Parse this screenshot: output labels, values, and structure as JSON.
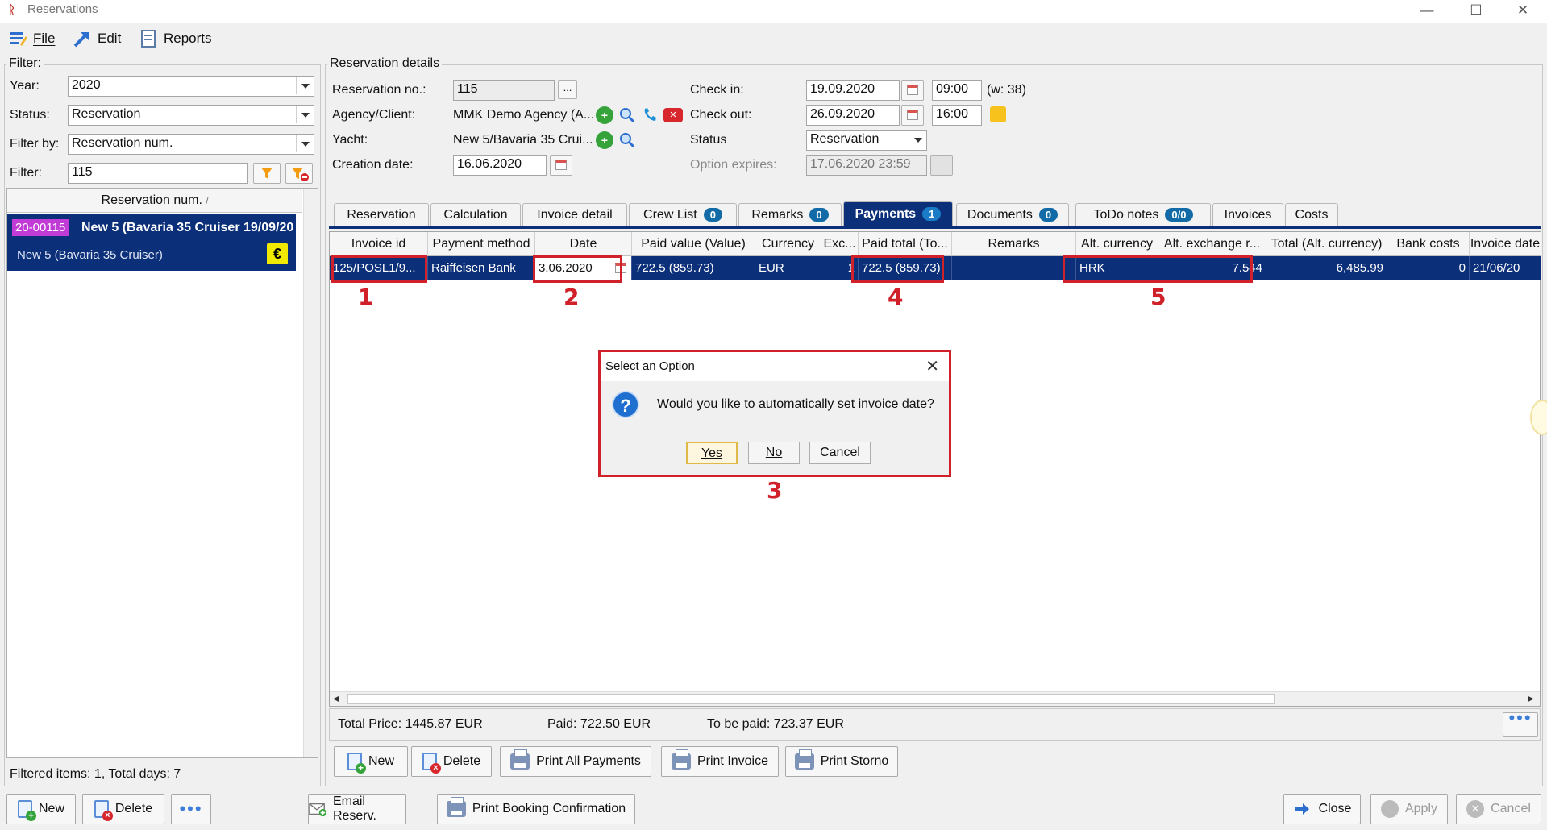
{
  "window": {
    "title": "Reservations"
  },
  "menu": {
    "file": "File",
    "edit": "Edit",
    "reports": "Reports"
  },
  "filter": {
    "legend": "Filter:",
    "year_label": "Year:",
    "year_value": "2020",
    "status_label": "Status:",
    "status_value": "Reservation",
    "filterby_label": "Filter by:",
    "filterby_value": "Reservation num.",
    "filter_label": "Filter:",
    "filter_value": "115"
  },
  "list": {
    "column_header": "Reservation num.",
    "sort_indicator": "/",
    "item": {
      "badge": "20-00115",
      "title": "New 5 (Bavaria 35 Cruiser 19/09/20",
      "subtitle": "New 5 (Bavaria 35 Cruiser)",
      "currency_symbol": "€"
    },
    "footer": "Filtered items: 1,  Total days: 7"
  },
  "details": {
    "legend": "Reservation details",
    "resno_label": "Reservation no.:",
    "resno_value": "115",
    "resno_btn": "...",
    "agency_label": "Agency/Client:",
    "agency_value": "MMK Demo Agency (A...",
    "yacht_label": "Yacht:",
    "yacht_value": "New 5/Bavaria 35 Crui...",
    "creation_label": "Creation date:",
    "creation_value": "16.06.2020",
    "checkin_label": "Check in:",
    "checkin_date": "19.09.2020",
    "checkin_time": "09:00",
    "week": "(w: 38)",
    "checkout_label": "Check out:",
    "checkout_date": "26.09.2020",
    "checkout_time": "16:00",
    "status_label": "Status",
    "status_value": "Reservation",
    "option_label": "Option expires:",
    "option_value": "17.06.2020 23:59"
  },
  "tabs": [
    {
      "label": "Reservation"
    },
    {
      "label": "Calculation"
    },
    {
      "label": "Invoice detail"
    },
    {
      "label": "Crew List",
      "badge": "0"
    },
    {
      "label": "Remarks",
      "badge": "0"
    },
    {
      "label": "Payments",
      "badge": "1"
    },
    {
      "label": "Documents",
      "badge": "0"
    },
    {
      "label": "ToDo notes",
      "badge": "0/0"
    },
    {
      "label": "Invoices"
    },
    {
      "label": "Costs"
    }
  ],
  "grid": {
    "headers": [
      "Invoice id",
      "Payment method",
      "Date",
      "Paid value (Value)",
      "Currency",
      "Exc...",
      "Paid total (To...",
      "Remarks",
      "Alt. currency",
      "Alt. exchange r...",
      "Total (Alt. currency)",
      "Bank costs",
      "Invoice date"
    ],
    "row": [
      "125/POSL1/9...",
      "Raiffeisen Bank",
      "3.06.2020",
      "722.5 (859.73)",
      "EUR",
      "1",
      "722.5 (859.73)",
      "",
      "HRK",
      "7.544",
      "6,485.99",
      "0",
      "21/06/20"
    ]
  },
  "annotations": [
    "1",
    "2",
    "3",
    "4",
    "5"
  ],
  "totals": {
    "price": "Total Price: 1445.87 EUR",
    "paid": "Paid: 722.50 EUR",
    "to_pay": "To be paid: 723.37 EUR"
  },
  "payment_buttons": {
    "new": "New",
    "delete": "Delete",
    "print_all": "Print All Payments",
    "print_invoice": "Print Invoice",
    "print_storno": "Print Storno"
  },
  "bottom_buttons": {
    "new": "New",
    "delete": "Delete",
    "email": "Email Reserv.",
    "print_booking": "Print Booking Confirmation",
    "close": "Close",
    "apply": "Apply",
    "cancel": "Cancel"
  },
  "dialog": {
    "title": "Select an Option",
    "message": "Would you like to automatically set invoice date?",
    "yes": "Yes",
    "no": "No",
    "cancel": "Cancel"
  },
  "colors": {
    "selection": "#0c2f79",
    "annotation": "#d0202a",
    "badge": "#126ba6",
    "list_badge": "#c13bd6"
  }
}
